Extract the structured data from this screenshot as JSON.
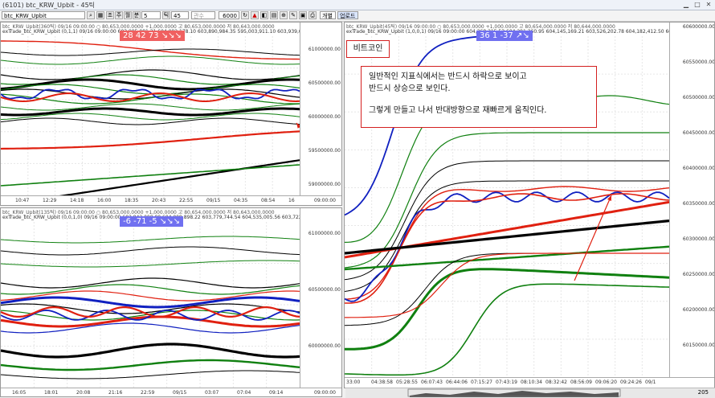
{
  "window": {
    "title": "(6101) btc_KRW_Upbit - 45틱",
    "minimize": "▁",
    "maximize": "□",
    "close": "✕"
  },
  "toolbar": {
    "symbol": "btc_KRW_Upbit",
    "bar_count": "5",
    "period": "45",
    "field": "관수",
    "count": "6000",
    "button_a": "개별",
    "button_b": "업로드",
    "icons": [
      "조",
      "주",
      "월",
      "분",
      "틱"
    ]
  },
  "pane_top_left": {
    "header1": "btc_KRW_Upbit(360틱) 09/16 09:00:00  ○ 80,653,000.0000  +1,000.0000  고 80,653,000.0000  저 80,643,000.0000",
    "header2": "exTrade_btc_KRW_Upbit (0,1,1) 09/16 09:00:00 603,995,081.21  604,092,178.10  603,890,984.35  595,003,911.10  603,939,000.00  606",
    "badge": "28   42   73 ↘↘↘",
    "y_labels": [
      "61000000.00",
      "60500000.00",
      "60000000.00",
      "59500000.00",
      "59000000.00"
    ],
    "x_labels": [
      "10:47",
      "12:29",
      "14:18",
      "16:00",
      "18:35",
      "20:43",
      "22:55",
      "09/15",
      "04:35",
      "08:54",
      "16"
    ],
    "x_last": "09:00:00",
    "x_ratio": "x10"
  },
  "pane_bottom_left": {
    "header1": "btc_KRW_Upbit(135틱) 09/16 09:00:00  ○ 80,653,000.0000  +1,000.0000  고 80,654,000.0000  저 80,643,000.0000",
    "header2": "exTrade_btc_KRW_Upbit (0,0,1,0) 09/16 09:00:00 603,842,000.00  604,009,898.22  603,779,744.54  604,535,005.56  603,722,650.00  606",
    "badge": "-6   -71   -5 ↘↘↘",
    "y_labels": [
      "61000000.00",
      "60500000.00",
      "60000000.00"
    ],
    "x_labels": [
      "16:05",
      "18:01",
      "20:08",
      "21:16",
      "22:59",
      "09/15",
      "03:07",
      "07:04",
      "09:14"
    ],
    "x_last": "09:00:00",
    "x_ratio": "x10"
  },
  "pane_right": {
    "header1": "btc_KRW_Upbit(45틱) 09/16 09:00:00  ○ 80,653,000.0000  +1,000.0000  고 80,654,000.0000  저 80,644,000.0000",
    "header2": "exTrade_btc_KRW_Upbit (1,0,0,1) 09/16 09:00:00 604,268,215.53  604,291,260.95  604,145,169.21  603,526,202.78  604,182,412.50  605,127,725.00",
    "badge": "36   1   -37 ↗↘",
    "label_bitcoin": "비트코인",
    "note_lines": [
      "일반적인 지표식에서는 반드시 하락으로 보이고",
      "반드시 상승으로 보인다.",
      "",
      "그렇게 만들고 나서 반대방향으로 재빠르게 움직인다."
    ],
    "y_labels": [
      "60600000.00",
      "60550000.00",
      "60500000.00",
      "60450000.00",
      "60400000.00",
      "60350000.00",
      "60300000.00",
      "60250000.00",
      "60200000.00",
      "60150000.00"
    ],
    "x_labels": [
      "33:00",
      "04:38:58",
      "05:28:55",
      "06:07:43",
      "06:44:06",
      "07:15:27",
      "07:43:19",
      "08:10:34",
      "08:32:42",
      "08:56:09",
      "09:06:20",
      "09:24:26",
      "09/1"
    ],
    "x_ratio": "x10",
    "scroll_value": "205"
  },
  "colors": {
    "red": "#e02010",
    "blue": "#1020c0",
    "black": "#000000",
    "green": "#108010",
    "note_border": "#d42020",
    "badge_red": "#f06060",
    "badge_blue": "#7070f0"
  }
}
